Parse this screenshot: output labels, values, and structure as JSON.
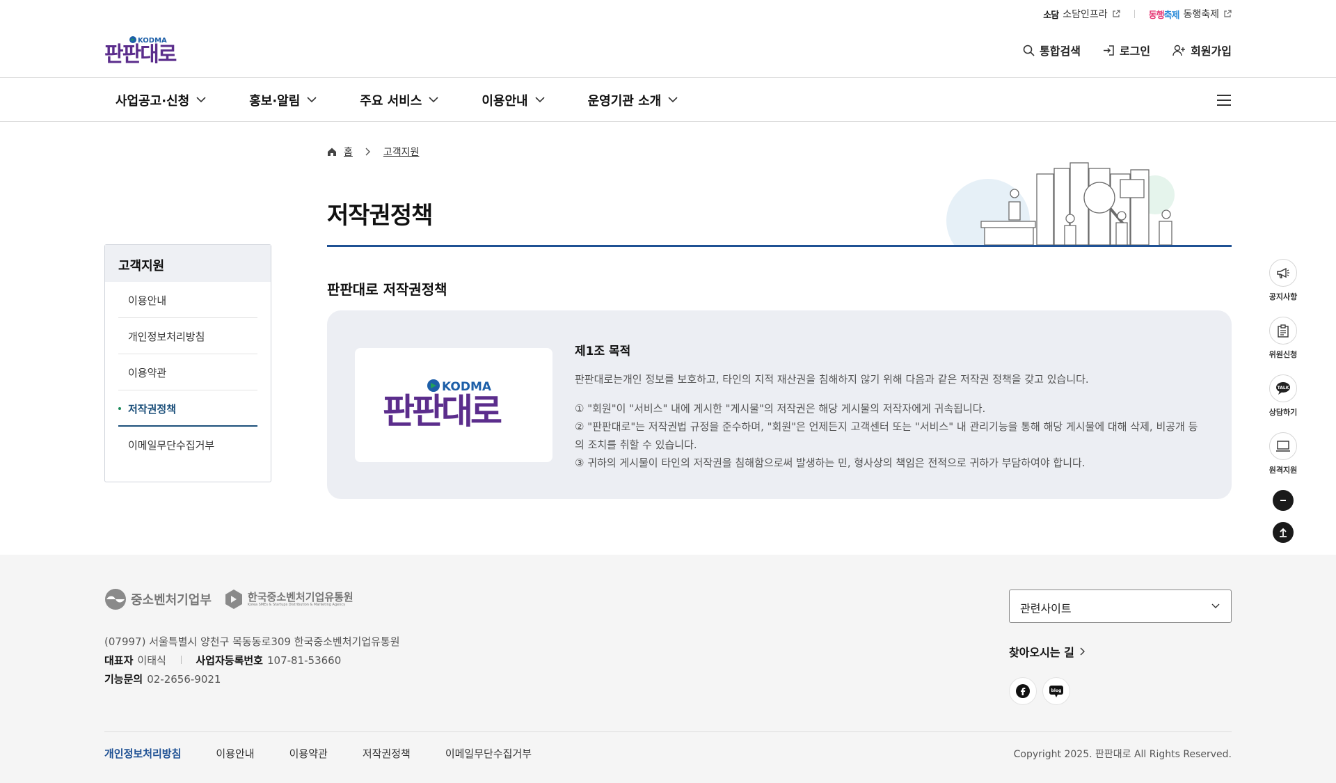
{
  "header": {
    "util_links": [
      {
        "logo_text": "소담",
        "label": "소담인프라"
      },
      {
        "logo_text_a": "동행",
        "logo_text_b": "축제",
        "label": "동행축제"
      }
    ],
    "logo_alt": "판판대로 KODMA",
    "member": {
      "search": "통합검색",
      "login": "로그인",
      "join": "회원가입"
    }
  },
  "gnb": {
    "items": [
      "사업공고·신청",
      "홍보·알림",
      "주요 서비스",
      "이용안내",
      "운영기관 소개"
    ]
  },
  "lnb": {
    "title": "고객지원",
    "items": [
      "이용안내",
      "개인정보처리방침",
      "이용약관",
      "저작권정책",
      "이메일무단수집거부"
    ],
    "active_index": 3
  },
  "breadcrumb": {
    "home": "홈",
    "current": "고객지원"
  },
  "page": {
    "title": "저작권정책",
    "section_title": "판판대로 저작권정책",
    "article": {
      "title": "제1조 목적",
      "lead": "판판대로는개인 정보를 보호하고, 타인의 지적 재산권을 침해하지 않기 위해 다음과 같은 저작권 정책을 갖고 있습니다.",
      "items": [
        "① \"회원\"이 \"서비스\" 내에 게시한 \"게시물\"의 저작권은 해당 게시물의 저작자에게 귀속됩니다.",
        "② \"판판대로\"는 저작권법 규정을 준수하며, \"회원\"은 언제든지 고객센터 또는 \"서비스\" 내 관리기능을 통해 해당 게시물에 대해 삭제, 비공개 등의 조치를 취할 수 있습니다.",
        "③ 귀하의 게시물이 타인의 저작권을 침해함으로써 발생하는 민, 형사상의 책임은 전적으로 귀하가 부담하여야 합니다."
      ]
    }
  },
  "quick_menu": {
    "items": [
      {
        "label": "공지사항",
        "icon": "megaphone-icon"
      },
      {
        "label": "위원신청",
        "icon": "clipboard-icon"
      },
      {
        "label": "상담하기",
        "icon": "talk-bubble-icon"
      },
      {
        "label": "원격지원",
        "icon": "monitor-icon"
      }
    ]
  },
  "footer": {
    "org1": "중소벤처기업부",
    "org2": "한국중소벤처기업유통원",
    "org2_en": "Korea SMEs & Startups Distribution & Marketing Agency",
    "address": "(07997) 서울특별시 양천구 목동동로309 한국중소벤처기업유통원",
    "ceo_label": "대표자",
    "ceo": "이태식",
    "biz_label": "사업자등록번호",
    "biz_no": "107-81-53660",
    "tel_label": "기능문의",
    "tel": "02-2656-9021",
    "related_sites": "관련사이트",
    "directions": "찾아오시는 길",
    "links": [
      "개인정보처리방침",
      "이용안내",
      "이용약관",
      "저작권정책",
      "이메일무단수집거부"
    ],
    "copyright": "Copyright 2025. 판판대로 All Rights Reserved.",
    "sns": [
      "facebook-icon",
      "blog-icon"
    ],
    "sns_blog_text": "blog"
  },
  "colors": {
    "brand_purple": "#5b2d8c",
    "kodma_blue": "#1d5fa8",
    "kodma_green": "#22a05a",
    "title_line": "#1f5194",
    "content_box": "#eceef3"
  }
}
